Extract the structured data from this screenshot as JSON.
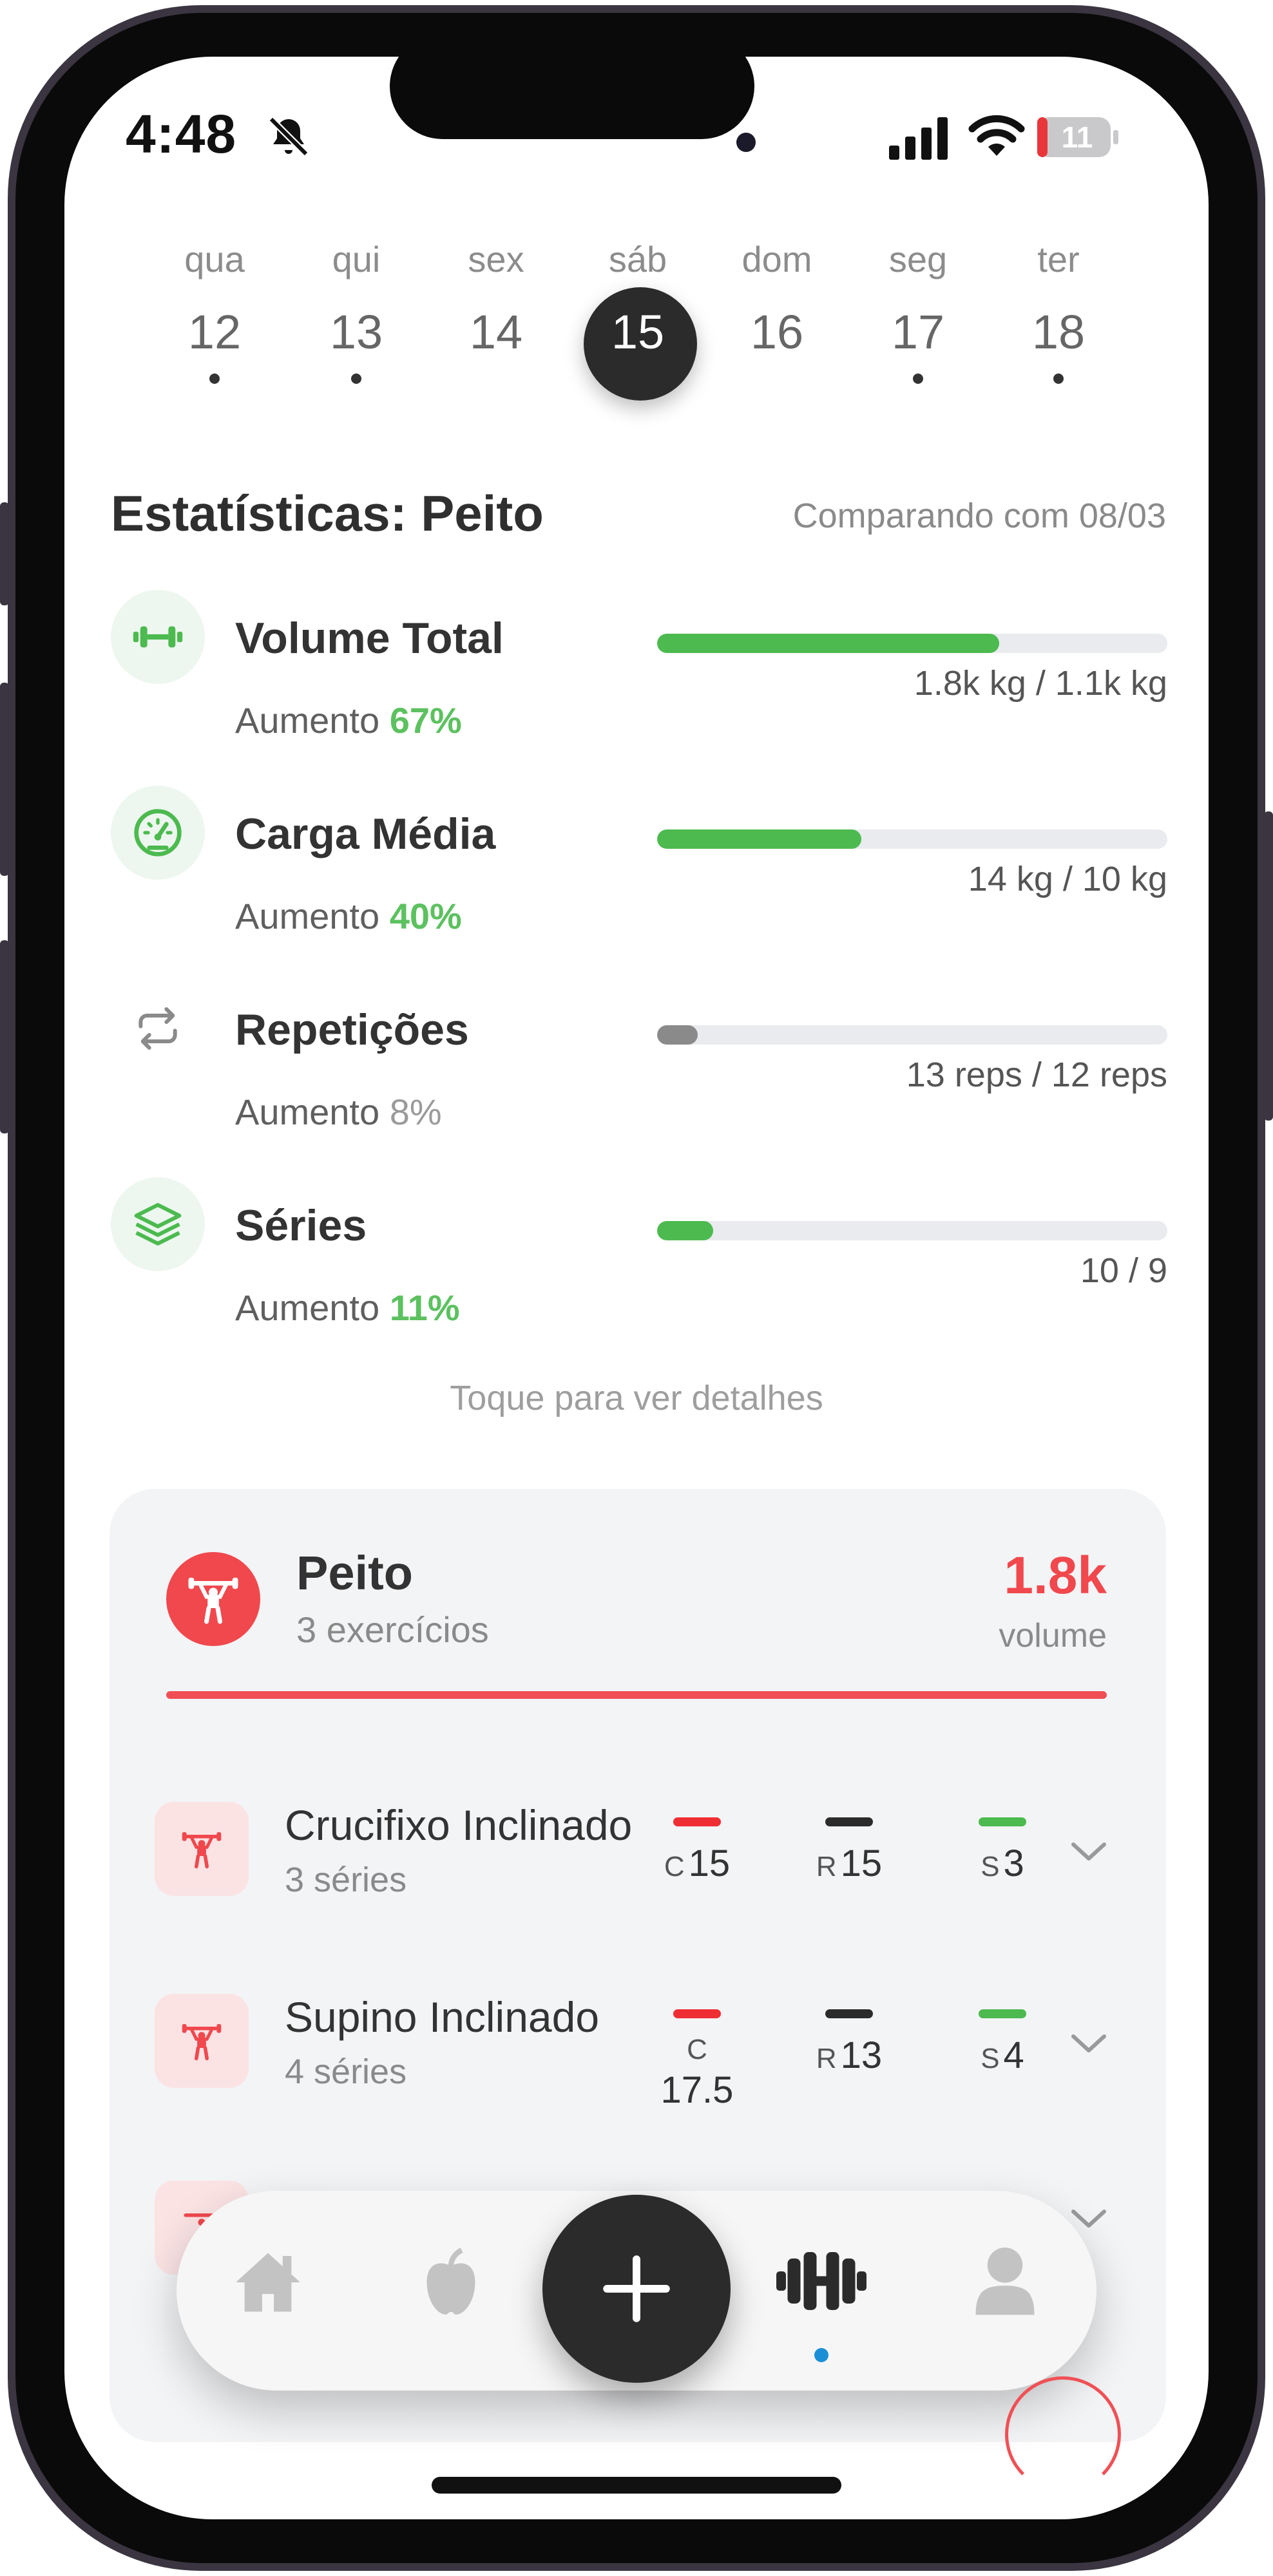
{
  "status_bar": {
    "time": "4:48",
    "battery": "11",
    "icons": [
      "bell-slash-icon",
      "cellular-signal-icon",
      "wifi-icon",
      "battery-icon"
    ]
  },
  "week": {
    "days": [
      {
        "name": "qua",
        "number": "12",
        "has_workout": true
      },
      {
        "name": "qui",
        "number": "13",
        "has_workout": true
      },
      {
        "name": "sex",
        "number": "14",
        "has_workout": false
      },
      {
        "name": "sáb",
        "number": "15",
        "has_workout": false,
        "selected": true
      },
      {
        "name": "dom",
        "number": "16",
        "has_workout": false
      },
      {
        "name": "seg",
        "number": "17",
        "has_workout": true
      },
      {
        "name": "ter",
        "number": "18",
        "has_workout": true
      }
    ]
  },
  "stats": {
    "title": "Estatísticas: Peito",
    "compare": "Comparando com 08/03",
    "items": [
      {
        "label": "Volume Total",
        "change_prefix": "Aumento",
        "change": "67%",
        "bar_fraction": 0.67,
        "bar_text": "1.8k kg / 1.1k kg",
        "color": "#4cba4f",
        "icon": "dumbbell-icon"
      },
      {
        "label": "Carga Média",
        "change_prefix": "Aumento",
        "change": "40%",
        "bar_fraction": 0.4,
        "bar_text": "14 kg / 10 kg",
        "color": "#4cba4f",
        "icon": "speedometer-icon"
      },
      {
        "label": "Repetições",
        "change_prefix": "Aumento",
        "change": "8%",
        "bar_fraction": 0.08,
        "bar_text": "13 reps / 12 reps",
        "color": "#8a8a8a",
        "icon": "repeat-icon"
      },
      {
        "label": "Séries",
        "change_prefix": "Aumento",
        "change": "11%",
        "bar_fraction": 0.11,
        "bar_text": "10 / 9",
        "color": "#4cba4f",
        "icon": "layers-icon"
      }
    ],
    "hint": "Toque para ver detalhes"
  },
  "group": {
    "name": "Peito",
    "exercise_count": "3 exercícios",
    "volume_value": "1.8k",
    "volume_label": "volume",
    "accent": "#f0484d",
    "exercises": [
      {
        "name": "Crucifixo Inclinado",
        "sets": "3 séries",
        "c_prefix": "C",
        "c_value": "15",
        "r_prefix": "R",
        "r_value": "15",
        "s_prefix": "S",
        "s_value": "3"
      },
      {
        "name": "Supino Inclinado",
        "sets": "4 séries",
        "c_prefix": "C",
        "c_value": "17.5",
        "r_prefix": "R",
        "r_value": "13",
        "s_prefix": "S",
        "s_value": "4"
      }
    ]
  },
  "tabbar": {
    "tabs": [
      "home-icon",
      "apple-icon",
      "add-icon",
      "dumbbell-icon",
      "profile-icon"
    ],
    "active": "dumbbell-icon"
  }
}
